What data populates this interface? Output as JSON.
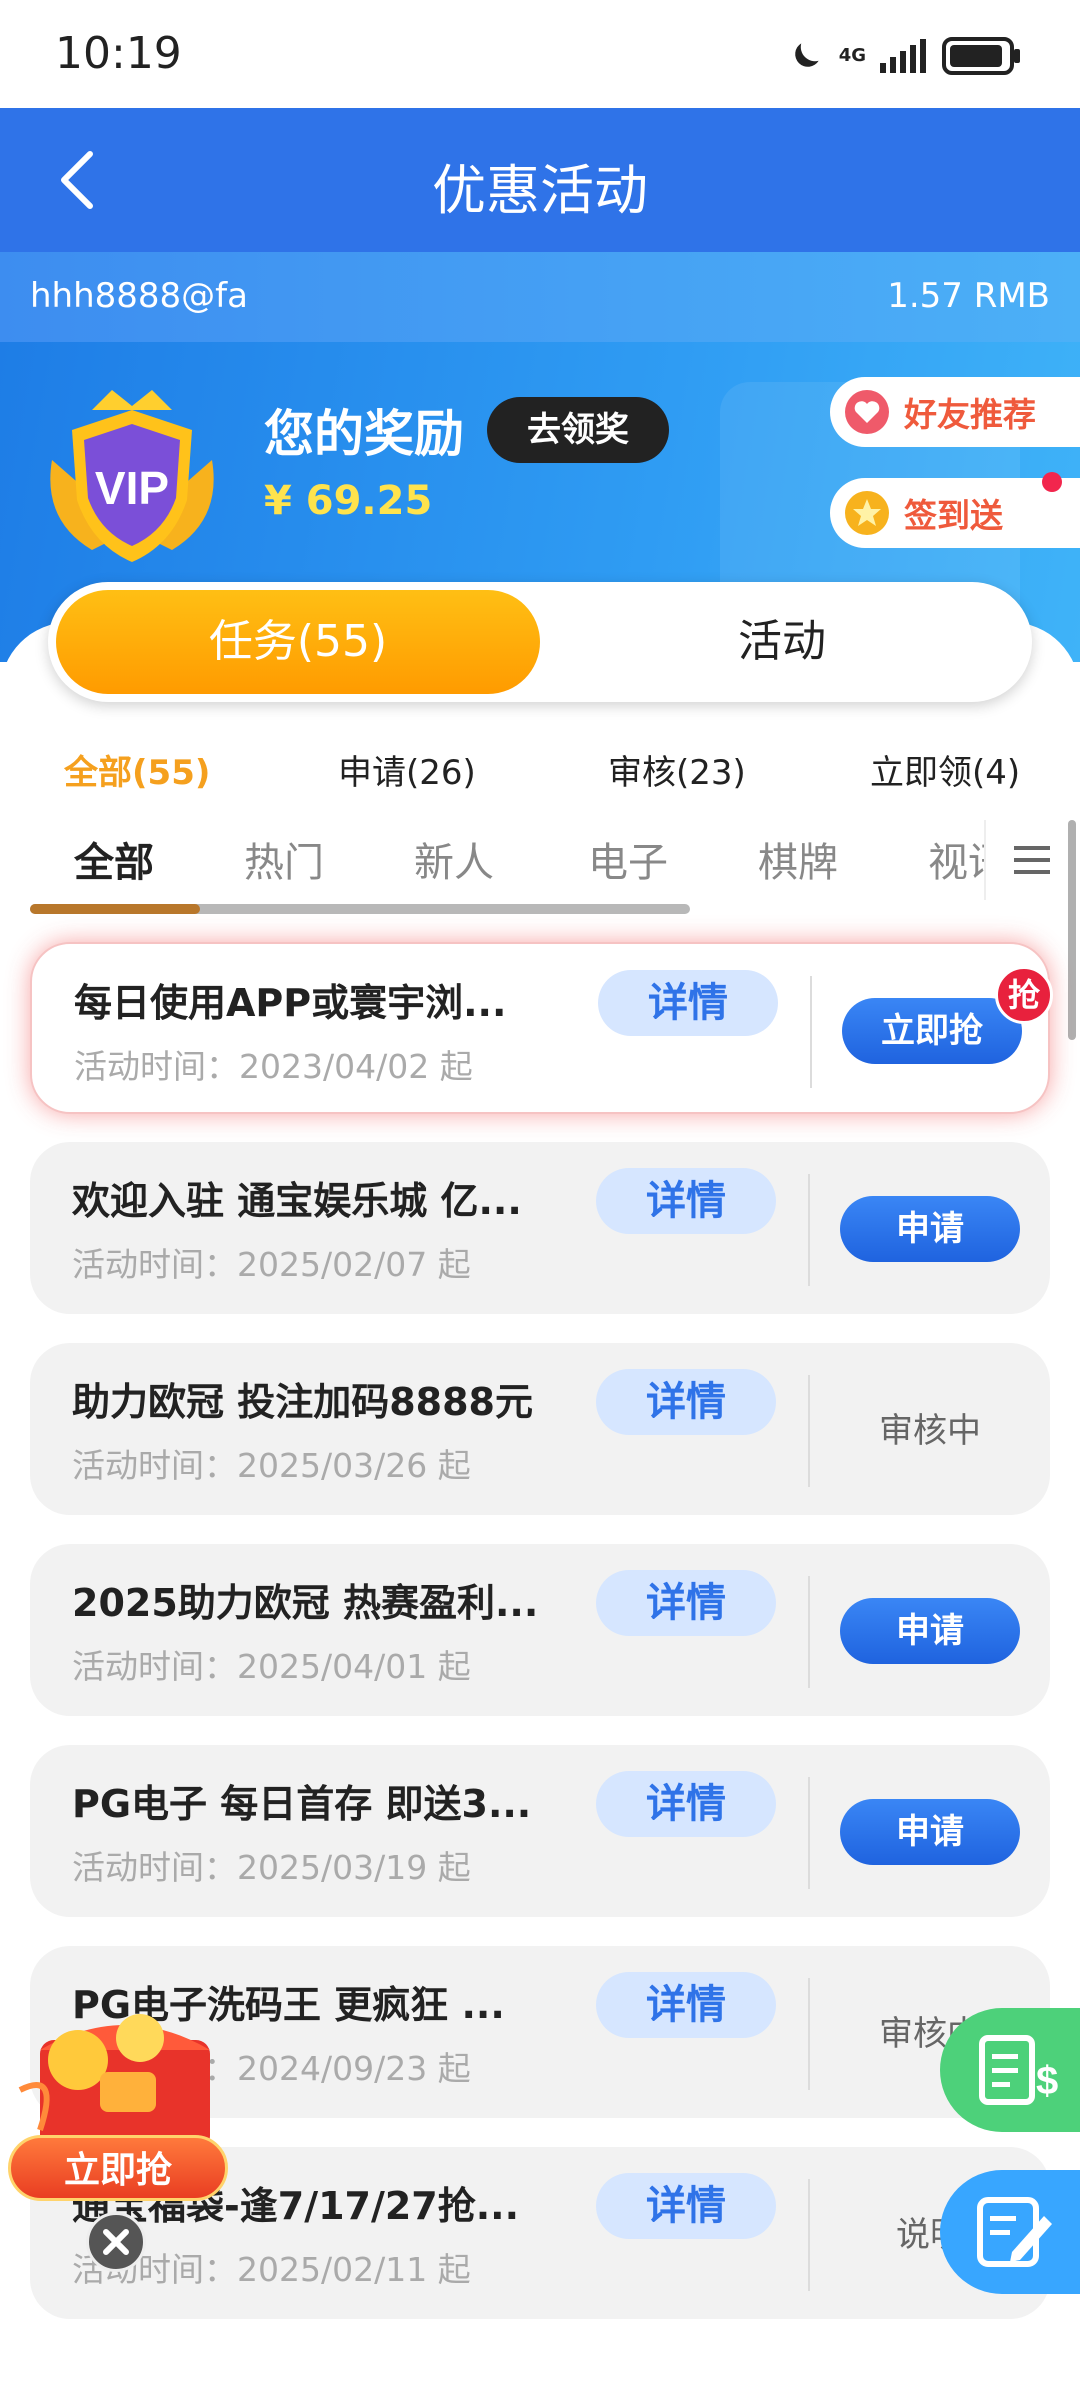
{
  "status_bar": {
    "time": "10:19",
    "network": "4G"
  },
  "header": {
    "title": "优惠活动"
  },
  "account": {
    "username": "hhh8888@fa",
    "balance": "1.57 RMB"
  },
  "reward": {
    "title": "您的奖励",
    "claim_label": "去领奖",
    "amount": "¥ 69.25",
    "vip_label": "VIP"
  },
  "side_buttons": {
    "referral": "好友推荐",
    "checkin": "签到送"
  },
  "segments": {
    "tasks": "任务(55)",
    "activities": "活动"
  },
  "filters": [
    "全部(55)",
    "申请(26)",
    "审核(23)",
    "立即领(4)"
  ],
  "categories": [
    "全部",
    "热门",
    "新人",
    "电子",
    "棋牌",
    "视讯"
  ],
  "detail_label": "详情",
  "cards": [
    {
      "title": "每日使用APP或寰宇浏...",
      "date": "活动时间：2023/04/02 起",
      "action": "立即抢",
      "action_type": "button",
      "badge": "抢",
      "hot": true
    },
    {
      "title": "欢迎入驻 通宝娱乐城 亿...",
      "date": "活动时间：2025/02/07 起",
      "action": "申请",
      "action_type": "button"
    },
    {
      "title": "助力欧冠 投注加码8888元",
      "date": "活动时间：2025/03/26 起",
      "action": "审核中",
      "action_type": "text"
    },
    {
      "title": "2025助力欧冠 热赛盈利...",
      "date": "活动时间：2025/04/01 起",
      "action": "申请",
      "action_type": "button"
    },
    {
      "title": "PG电子 每日首存 即送3...",
      "date": "活动时间：2025/03/19 起",
      "action": "申请",
      "action_type": "button"
    },
    {
      "title": "PG电子洗码王 更疯狂 ...",
      "date": "活动时间：2024/09/23 起",
      "action": "审核中",
      "action_type": "text"
    },
    {
      "title": "通宝福袋-逢7/17/27抢...",
      "date": "活动时间：2025/02/11 起",
      "action": "说明",
      "action_type": "text"
    }
  ],
  "floating": {
    "redpack_label": "立即抢"
  },
  "colors": {
    "primary": "#2f73e8",
    "accent": "#ff9b00",
    "gold": "#ffe34d",
    "danger": "#e8213d"
  }
}
